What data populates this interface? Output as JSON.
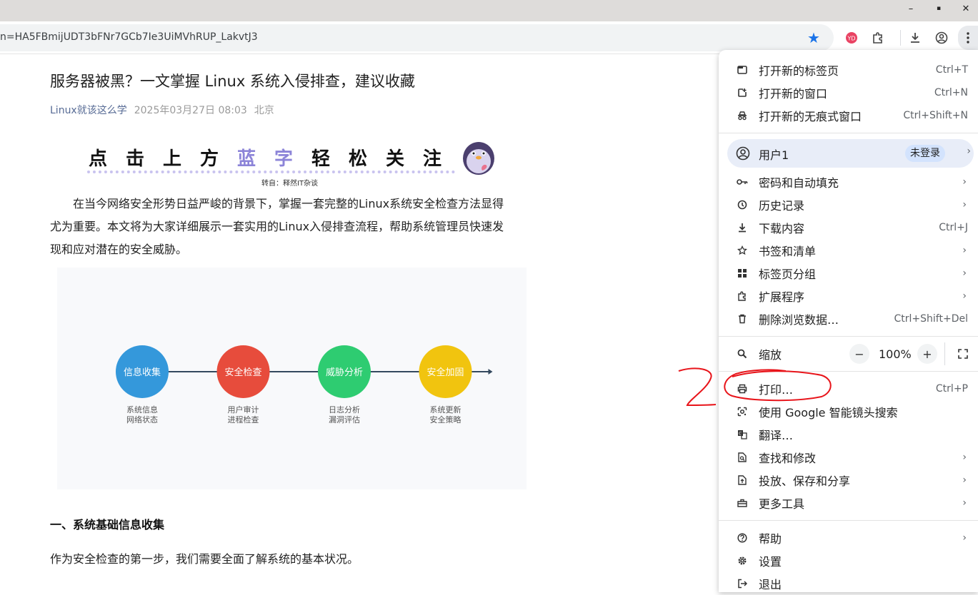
{
  "window": {
    "minimize_glyph": "–",
    "maximize_glyph": "▪",
    "close_glyph": "✕"
  },
  "toolbar": {
    "url": "n=HA5FBmijUDT3bFNr7GCb7Ie3UiMVhRUP_LakvtJ3",
    "bookmark_icon": "star-filled-icon",
    "accent_color": "#1a73e8"
  },
  "article": {
    "title": "服务器被黑？一文掌握 Linux 系统入侵排查，建议收藏",
    "author": "Linux就该这么学",
    "date": "2025年03月27日 08:03",
    "location": "北京",
    "banner": {
      "chars": [
        "点",
        "击",
        "上",
        "方",
        "蓝",
        "字",
        "轻",
        "松",
        "关",
        "注"
      ],
      "source": "转自：释然IT杂谈"
    },
    "intro": "在当今网络安全形势日益严峻的背景下，掌握一套完整的Linux系统安全检查方法显得尤为重要。本文将为大家详细展示一套实用的Linux入侵排查流程，帮助系统管理员快速发现和应对潜在的安全威胁。",
    "intro_lines": [
      "　　在当今网络安全形势日益严峻的背景下，掌握一套完整的Linux系统安全检查方法显得",
      "尤为重要。本文将为大家详细展示一套实用的Linux入侵排查流程，帮助系统管理员快速发",
      "现和应对潜在的安全威胁。"
    ],
    "diagram": {
      "steps": [
        {
          "label": "信息收集",
          "color": "#3498db",
          "sub1": "系统信息",
          "sub2": "网络状态"
        },
        {
          "label": "安全检查",
          "color": "#e74c3c",
          "sub1": "用户审计",
          "sub2": "进程检查"
        },
        {
          "label": "威胁分析",
          "color": "#2ecc71",
          "sub1": "日志分析",
          "sub2": "漏洞评估"
        },
        {
          "label": "安全加固",
          "color": "#f1c40f",
          "sub1": "系统更新",
          "sub2": "安全策略"
        }
      ]
    },
    "section_heading": "一、系统基础信息收集",
    "section_text": "作为安全检查的第一步，我们需要全面了解系统的基本状况。"
  },
  "menu": {
    "group1": [
      {
        "icon": "new-tab-icon",
        "label": "打开新的标签页",
        "shortcut": "Ctrl+T"
      },
      {
        "icon": "new-window-icon",
        "label": "打开新的窗口",
        "shortcut": "Ctrl+N"
      },
      {
        "icon": "incognito-icon",
        "label": "打开新的无痕式窗口",
        "shortcut": "Ctrl+Shift+N"
      }
    ],
    "profile": {
      "icon": "account-icon",
      "label": "用户1",
      "badge": "未登录"
    },
    "group2": [
      {
        "icon": "key-icon",
        "label": "密码和自动填充",
        "shortcut": "",
        "submenu": true
      },
      {
        "icon": "history-icon",
        "label": "历史记录",
        "shortcut": "",
        "submenu": true
      },
      {
        "icon": "download-icon",
        "label": "下载内容",
        "shortcut": "Ctrl+J",
        "submenu": false
      },
      {
        "icon": "star-outline-icon",
        "label": "书签和清单",
        "shortcut": "",
        "submenu": true
      },
      {
        "icon": "tab-groups-icon",
        "label": "标签页分组",
        "shortcut": "",
        "submenu": true
      },
      {
        "icon": "extension-icon",
        "label": "扩展程序",
        "shortcut": "",
        "submenu": true
      },
      {
        "icon": "trash-icon",
        "label": "删除浏览数据…",
        "shortcut": "Ctrl+Shift+Del",
        "submenu": false
      }
    ],
    "zoom": {
      "icon": "zoom-icon",
      "label": "缩放",
      "minus": "−",
      "value": "100%",
      "plus": "+",
      "fullscreen_icon": "fullscreen-icon"
    },
    "group3": [
      {
        "icon": "print-icon",
        "label": "打印…",
        "shortcut": "Ctrl+P",
        "submenu": false
      },
      {
        "icon": "google-lens-icon",
        "label": "使用 Google 智能镜头搜索",
        "shortcut": "",
        "submenu": false
      },
      {
        "icon": "translate-icon",
        "label": "翻译…",
        "shortcut": "",
        "submenu": false
      },
      {
        "icon": "find-icon",
        "label": "查找和修改",
        "shortcut": "",
        "submenu": true
      },
      {
        "icon": "cast-save-share-icon",
        "label": "投放、保存和分享",
        "shortcut": "",
        "submenu": true
      },
      {
        "icon": "toolbox-icon",
        "label": "更多工具",
        "shortcut": "",
        "submenu": true
      }
    ],
    "group4": [
      {
        "icon": "help-icon",
        "label": "帮助",
        "shortcut": "",
        "submenu": true
      },
      {
        "icon": "settings-icon",
        "label": "设置",
        "shortcut": "",
        "submenu": false
      },
      {
        "icon": "exit-icon",
        "label": "退出",
        "shortcut": "",
        "submenu": false
      }
    ]
  },
  "annotation": {
    "color": "#e8141a",
    "text": "2"
  }
}
